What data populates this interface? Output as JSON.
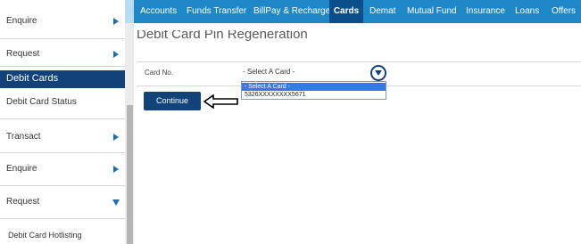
{
  "nav": {
    "items": [
      "Accounts",
      "Funds Transfer",
      "BillPay & Recharge",
      "Cards",
      "Demat",
      "Mutual Fund",
      "Insurance",
      "Loans",
      "Offers"
    ],
    "active": "Cards"
  },
  "sidebar": {
    "items": [
      {
        "label": "Enquire",
        "arrow": "right"
      },
      {
        "label": "Request",
        "arrow": "right"
      },
      {
        "label": "Debit Cards",
        "active": true
      },
      {
        "label": "Debit Card Status"
      },
      {
        "label": "Transact",
        "arrow": "right"
      },
      {
        "label": "Enquire",
        "arrow": "right"
      },
      {
        "label": "Request",
        "arrow": "down"
      },
      {
        "label": "Debit Card Hotlisting"
      }
    ]
  },
  "page": {
    "title": "Debit Card Pin Regeneration"
  },
  "form": {
    "card_label": "Card No.",
    "select_value": "- Select A Card -",
    "options": [
      "- Select A Card -",
      "5326XXXXXXXX5671"
    ],
    "continue_label": "Continue"
  },
  "colors": {
    "nav_bg": "#1e87c8",
    "nav_active": "#0b4f8a",
    "accent": "#11427a",
    "dropdown_highlight": "#3b78e7"
  },
  "icons": [
    "chevron-right-icon",
    "chevron-down-icon",
    "dropdown-circle-icon",
    "pointer-arrow-icon"
  ]
}
